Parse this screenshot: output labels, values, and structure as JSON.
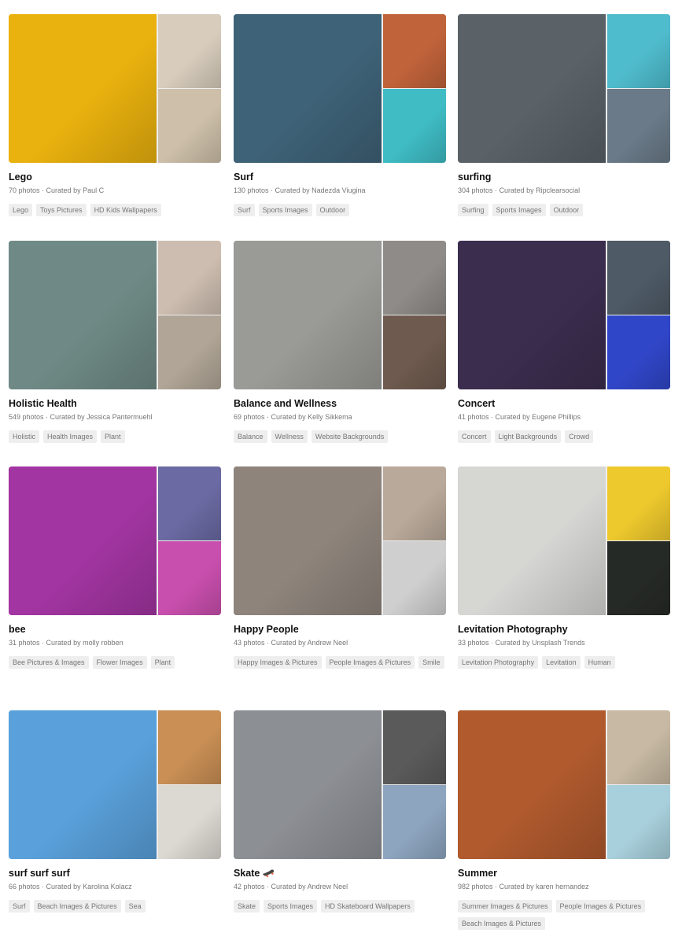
{
  "collections": [
    {
      "title": "Lego",
      "photos": "70 photos",
      "curator": "Curated by Paul C",
      "tags": [
        "Lego",
        "Toys Pictures",
        "HD Kids Wallpapers"
      ],
      "colors": {
        "big": "#eab20e",
        "s1": "#d8cdbd",
        "s2": "#cdbfa9"
      }
    },
    {
      "title": "Surf",
      "photos": "130 photos",
      "curator": "Curated by Nadezda Viugina",
      "tags": [
        "Surf",
        "Sports Images",
        "Outdoor"
      ],
      "colors": {
        "big": "#3e6277",
        "s1": "#c0633a",
        "s2": "#3fbcc4"
      }
    },
    {
      "title": "surfing",
      "photos": "304 photos",
      "curator": "Curated by Ripclearsocial",
      "tags": [
        "Surfing",
        "Sports Images",
        "Outdoor"
      ],
      "colors": {
        "big": "#5a6268",
        "s1": "#4fbccd",
        "s2": "#6a7a88"
      }
    },
    {
      "title": "Holistic Health",
      "photos": "549 photos",
      "curator": "Curated by Jessica Pantermuehl",
      "tags": [
        "Holistic",
        "Health Images",
        "Plant"
      ],
      "colors": {
        "big": "#6f8a86",
        "s1": "#cdbdb0",
        "s2": "#b0a596"
      }
    },
    {
      "title": "Balance and Wellness",
      "photos": "69 photos",
      "curator": "Curated by Kelly Sikkema",
      "tags": [
        "Balance",
        "Wellness",
        "Website Backgrounds"
      ],
      "colors": {
        "big": "#9a9a96",
        "s1": "#8e8b88",
        "s2": "#6e5a4e"
      }
    },
    {
      "title": "Concert",
      "photos": "41 photos",
      "curator": "Curated by Eugene Phillips",
      "tags": [
        "Concert",
        "Light Backgrounds",
        "Crowd"
      ],
      "colors": {
        "big": "#3b2d4e",
        "s1": "#4e5a66",
        "s2": "#3046c8"
      }
    },
    {
      "title": "bee",
      "photos": "31 photos",
      "curator": "Curated by molly robben",
      "tags": [
        "Bee Pictures & Images",
        "Flower Images",
        "Plant"
      ],
      "colors": {
        "big": "#a335a2",
        "s1": "#6b6aa3",
        "s2": "#c94fae"
      }
    },
    {
      "title": "Happy People",
      "photos": "43 photos",
      "curator": "Curated by Andrew Neel",
      "tags": [
        "Happy Images & Pictures",
        "People Images & Pictures",
        "Smile"
      ],
      "colors": {
        "big": "#8e847c",
        "s1": "#b9a99a",
        "s2": "#cfcfcf"
      }
    },
    {
      "title": "Levitation Photography",
      "photos": "33 photos",
      "curator": "Curated by Unsplash Trends",
      "tags": [
        "Levitation Photography",
        "Levitation",
        "Human"
      ],
      "colors": {
        "big": "#d6d6d3",
        "s1": "#eec92d",
        "s2": "#262a26"
      }
    },
    {
      "title": "surf surf surf",
      "photos": "66 photos",
      "curator": "Curated by Karolina Kolacz",
      "tags": [
        "Surf",
        "Beach Images & Pictures",
        "Sea"
      ],
      "colors": {
        "big": "#5aa1db",
        "s1": "#c98f55",
        "s2": "#dcd8d2"
      }
    },
    {
      "title": "Skate 🛹",
      "photos": "42 photos",
      "curator": "Curated by Andrew Neel",
      "tags": [
        "Skate",
        "Sports Images",
        "HD Skateboard Wallpapers"
      ],
      "colors": {
        "big": "#8c8f94",
        "s1": "#5a5a5a",
        "s2": "#8da5bf"
      }
    },
    {
      "title": "Summer",
      "photos": "982 photos",
      "curator": "Curated by karen hernandez",
      "tags": [
        "Summer Images & Pictures",
        "People Images & Pictures",
        "Beach Images & Pictures"
      ],
      "colors": {
        "big": "#b05a2e",
        "s1": "#c7b9a3",
        "s2": "#a8d0dc"
      }
    }
  ]
}
